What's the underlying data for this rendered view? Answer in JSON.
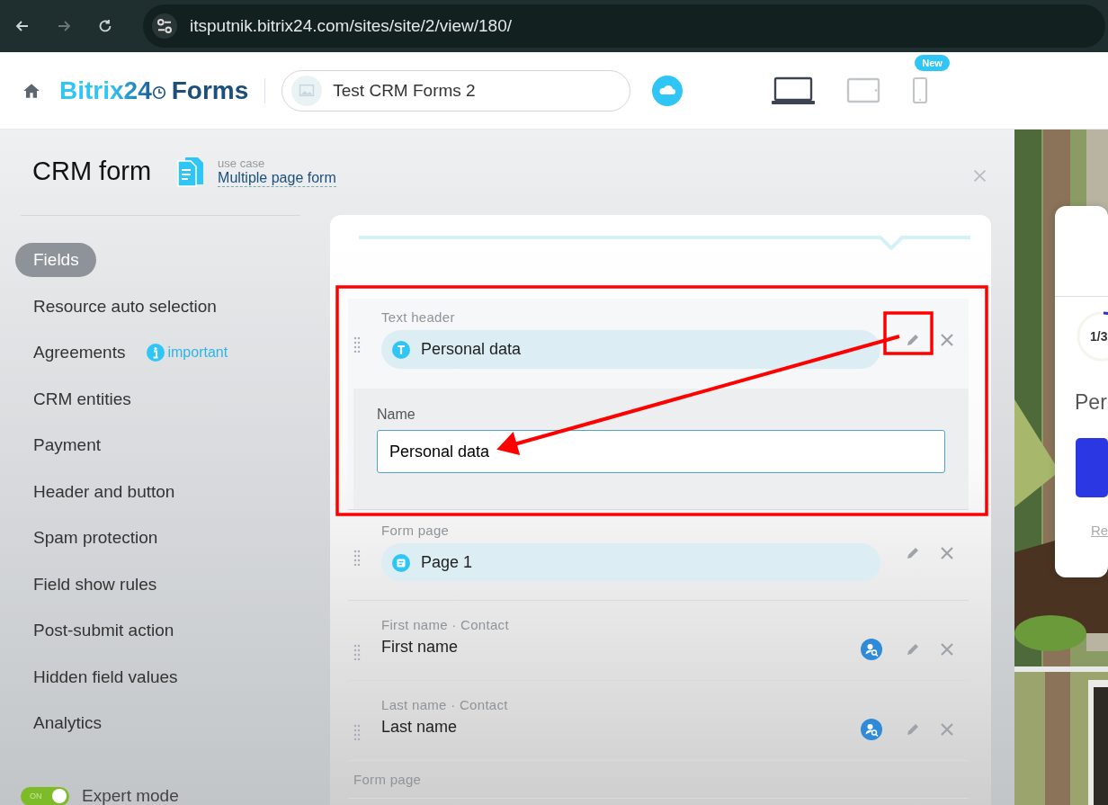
{
  "browser": {
    "url": "itsputnik.bitrix24.com/sites/site/2/view/180/"
  },
  "header": {
    "logo_part1": "Bitrix24",
    "logo_part2": "Forms",
    "site_name": "Test CRM Forms 2",
    "devices": [
      {
        "kind": "laptop",
        "selected": true
      },
      {
        "kind": "tablet",
        "selected": false
      },
      {
        "kind": "phone",
        "selected": false,
        "badge": "New"
      }
    ]
  },
  "panel": {
    "title": "CRM form",
    "use_case_label": "use case",
    "use_case": "Multiple page form"
  },
  "sidebar": {
    "items": [
      {
        "label": "Fields",
        "selected": true
      },
      {
        "label": "Resource auto selection",
        "selected": false
      },
      {
        "label": "Agreements",
        "selected": false,
        "note": "important"
      },
      {
        "label": "CRM entities",
        "selected": false
      },
      {
        "label": "Payment",
        "selected": false
      },
      {
        "label": "Header and button",
        "selected": false
      },
      {
        "label": "Spam protection",
        "selected": false
      },
      {
        "label": "Field show rules",
        "selected": false
      },
      {
        "label": "Post-submit action",
        "selected": false
      },
      {
        "label": "Hidden field values",
        "selected": false
      },
      {
        "label": "Analytics",
        "selected": false
      }
    ],
    "expert_mode": {
      "label": "Expert mode",
      "switch_text": "ON",
      "on": true
    }
  },
  "fields": [
    {
      "kind": "header",
      "caption": "Text header",
      "value": "Personal data",
      "expanded": true,
      "name_label": "Name",
      "name_value": "Personal data"
    },
    {
      "kind": "page",
      "caption": "Form page",
      "value": "Page 1",
      "expanded": false
    },
    {
      "kind": "field",
      "caption": "First name · Contact",
      "value": "First name",
      "expanded": false
    },
    {
      "kind": "field",
      "caption": "Last name · Contact",
      "value": "Last name",
      "expanded": false
    },
    {
      "kind": "cut",
      "caption": "Form page"
    }
  ],
  "preview": {
    "step": "1/3",
    "heading": "Per",
    "link": "Re"
  }
}
